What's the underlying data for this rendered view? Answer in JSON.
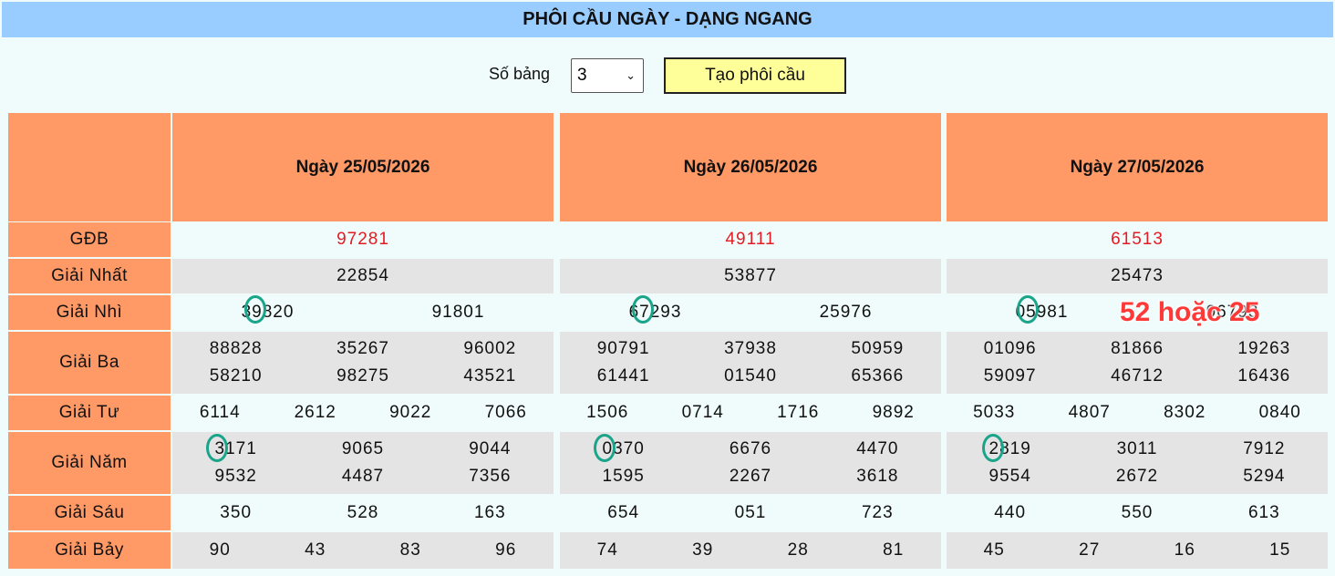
{
  "header": {
    "title": "PHÔI CẦU NGÀY - DẠNG NGANG"
  },
  "controls": {
    "count_label": "Số bảng",
    "count_value": "3",
    "generate_label": "Tạo phôi cầu"
  },
  "row_labels": [
    "GĐB",
    "Giải Nhất",
    "Giải Nhì",
    "Giải Ba",
    "Giải Tư",
    "Giải Năm",
    "Giải Sáu",
    "Giải Bảy"
  ],
  "tables": [
    {
      "date": "Ngày 25/05/2026",
      "gdb": "97281",
      "g1": "22854",
      "g2": [
        "39820",
        "91801"
      ],
      "g3": [
        "88828",
        "35267",
        "96002",
        "58210",
        "98275",
        "43521"
      ],
      "g4": [
        "6114",
        "2612",
        "9022",
        "7066"
      ],
      "g5": [
        "3171",
        "9065",
        "9044",
        "9532",
        "4487",
        "7356"
      ],
      "g6": [
        "350",
        "528",
        "163"
      ],
      "g7": [
        "90",
        "43",
        "83",
        "96"
      ]
    },
    {
      "date": "Ngày 26/05/2026",
      "gdb": "49111",
      "g1": "53877",
      "g2": [
        "67293",
        "25976"
      ],
      "g3": [
        "90791",
        "37938",
        "50959",
        "61441",
        "01540",
        "65366"
      ],
      "g4": [
        "1506",
        "0714",
        "1716",
        "9892"
      ],
      "g5": [
        "0370",
        "6676",
        "4470",
        "1595",
        "2267",
        "3618"
      ],
      "g6": [
        "654",
        "051",
        "723"
      ],
      "g7": [
        "74",
        "39",
        "28",
        "81"
      ]
    },
    {
      "date": "Ngày 27/05/2026",
      "gdb": "61513",
      "g1": "25473",
      "g2": [
        "05981",
        "96793"
      ],
      "g3": [
        "01096",
        "81866",
        "19263",
        "59097",
        "46712",
        "16436"
      ],
      "g4": [
        "5033",
        "4807",
        "8302",
        "0840"
      ],
      "g5": [
        "2819",
        "3011",
        "7912",
        "9554",
        "2672",
        "5294"
      ],
      "g6": [
        "440",
        "550",
        "613"
      ],
      "g7": [
        "45",
        "27",
        "16",
        "15"
      ]
    }
  ],
  "annotation": "52 hoặc 25",
  "colors": {
    "title_bg": "#99ccff",
    "header_bg": "#ff9966",
    "row_light": "#effcfb",
    "row_gray": "#e4e4e4",
    "gdb_text": "#e31b23",
    "circle": "#1aa58a",
    "annotation": "#ff3838",
    "button_bg": "#ffff99"
  }
}
